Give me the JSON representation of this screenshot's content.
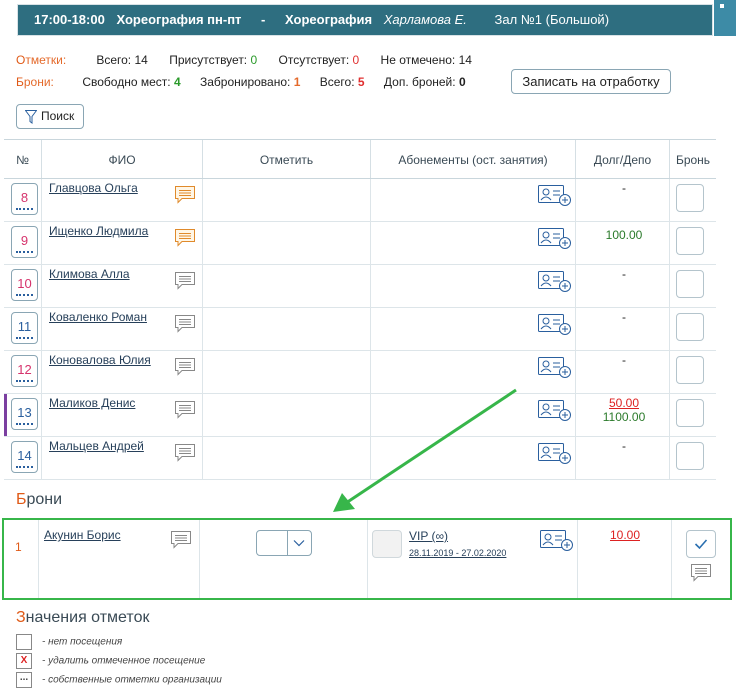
{
  "header": {
    "time": "17:00-18:00",
    "class_name": "Хореография пн-пт",
    "dash": "-",
    "style": "Хореография",
    "teacher": "Харламова Е.",
    "hall": "Зал №1 (Большой)"
  },
  "marks_summary": {
    "label": "Отметки:",
    "total_label": "Всего:",
    "total": "14",
    "present_label": "Присутствует:",
    "present": "0",
    "absent_label": "Отсутствует:",
    "absent": "0",
    "unmarked_label": "Не отмечено:",
    "unmarked": "14"
  },
  "bookings_summary": {
    "label": "Брони:",
    "free_label": "Свободно мест:",
    "free": "4",
    "booked_label": "Забронировано:",
    "booked": "1",
    "total_label": "Всего:",
    "total": "5",
    "extra_label": "Доп. броней:",
    "extra": "0"
  },
  "buttons": {
    "makeup": "Записать на отработку",
    "search": "Поиск"
  },
  "table": {
    "columns": [
      "№",
      "ФИО",
      "Отметить",
      "Абонементы (ост. занятия)",
      "Долг/Депо",
      "Бронь"
    ],
    "rows": [
      {
        "num": "8",
        "name": "Главцова Ольга",
        "debt": "-",
        "depo": "",
        "comment": "orange"
      },
      {
        "num": "9",
        "name": "Ищенко Людмила",
        "debt": "",
        "depo": "100.00",
        "comment": "orange"
      },
      {
        "num": "10",
        "name": "Климова Алла",
        "debt": "-",
        "depo": "",
        "comment": "gray"
      },
      {
        "num": "11",
        "name": "Коваленко Роман",
        "debt": "-",
        "depo": "",
        "comment": "gray"
      },
      {
        "num": "12",
        "name": "Коновалова Юлия",
        "debt": "-",
        "depo": "",
        "comment": "gray"
      },
      {
        "num": "13",
        "name": "Маликов Денис",
        "debt": "50.00",
        "depo": "1100.00",
        "comment": "gray"
      },
      {
        "num": "14",
        "name": "Мальцев Андрей",
        "debt": "-",
        "depo": "",
        "comment": "gray"
      }
    ]
  },
  "bookings": {
    "title": "Брони",
    "row": {
      "num": "1",
      "name": "Акунин Борис",
      "subscription": "VIP (∞)",
      "dates": "28.11.2019 - 27.02.2020",
      "debt": "10.00"
    }
  },
  "legend": {
    "title": "Значения отметок",
    "items": [
      {
        "symbol": "",
        "text": "- нет посещения"
      },
      {
        "symbol": "X",
        "text": "- удалить отмеченное посещение"
      },
      {
        "symbol": "...",
        "text": "- собственные отметки организации"
      }
    ]
  },
  "colors": {
    "header_bg": "#2e6e80",
    "accent_orange": "#e05a17",
    "highlight_green": "#37b64a",
    "link": "#27405a",
    "number_pink": "#d6336c"
  }
}
